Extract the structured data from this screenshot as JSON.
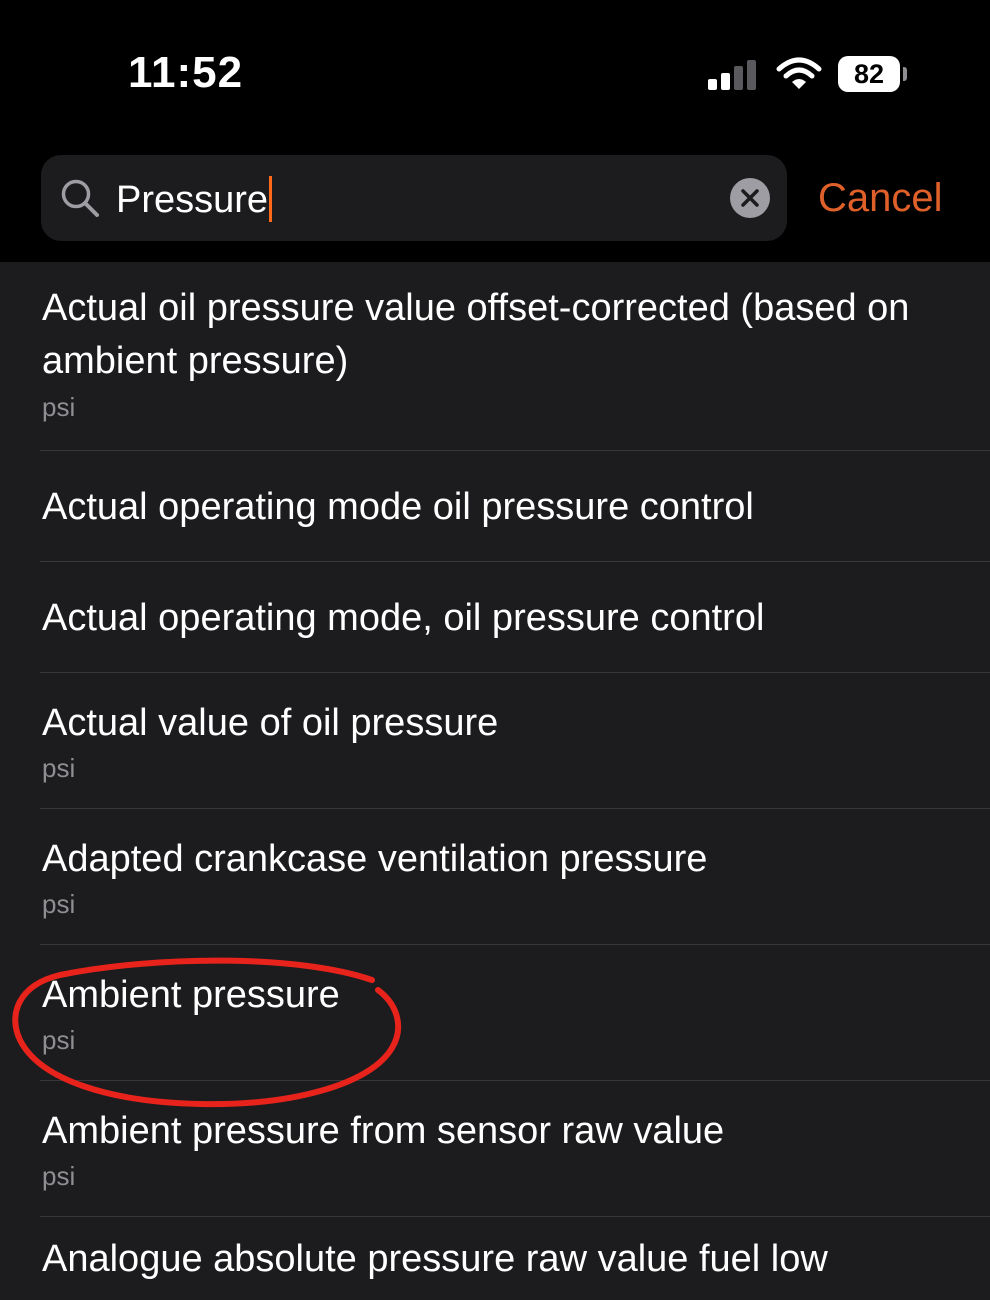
{
  "status_bar": {
    "time": "11:52",
    "battery": "82",
    "signal_icon": "cellular-signal-icon",
    "wifi_icon": "wifi-icon"
  },
  "search": {
    "query": "Pressure",
    "cancel_label": "Cancel",
    "icon": "search-icon",
    "clear_icon": "clear-icon"
  },
  "results": [
    {
      "title": "Actual oil pressure value offset-corrected (based on ambient pressure)",
      "unit": "psi"
    },
    {
      "title": "Actual operating mode oil pressure control",
      "unit": ""
    },
    {
      "title": "Actual operating mode, oil pressure control",
      "unit": ""
    },
    {
      "title": "Actual value of oil pressure",
      "unit": "psi"
    },
    {
      "title": "Adapted crankcase ventilation pressure",
      "unit": "psi"
    },
    {
      "title": "Ambient pressure",
      "unit": "psi"
    },
    {
      "title": "Ambient pressure from sensor raw value",
      "unit": "psi"
    },
    {
      "title": "Analogue absolute pressure raw value fuel low",
      "unit": ""
    }
  ],
  "colors": {
    "accent": "#e0602a",
    "background": "#000000",
    "list_background": "#1c1c1e",
    "annotation": "#e8231c"
  }
}
